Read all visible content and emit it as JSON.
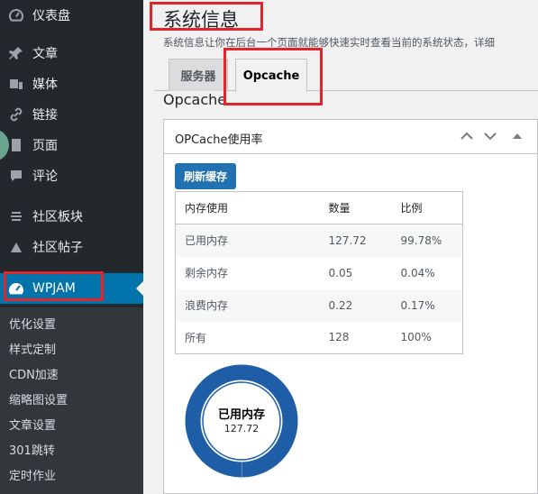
{
  "sidebar": {
    "items": [
      {
        "label": "仪表盘",
        "icon": "dashboard-icon"
      },
      {
        "label": "文章",
        "icon": "pin-icon"
      },
      {
        "label": "媒体",
        "icon": "media-icon"
      },
      {
        "label": "链接",
        "icon": "link-icon"
      },
      {
        "label": "页面",
        "icon": "page-icon"
      },
      {
        "label": "评论",
        "icon": "comment-icon"
      },
      {
        "label": "社区板块",
        "icon": "forum-icon"
      },
      {
        "label": "社区帖子",
        "icon": "topic-icon"
      },
      {
        "label": "WPJAM",
        "icon": "gauge-icon"
      }
    ],
    "submenu": [
      "优化设置",
      "样式定制",
      "CDN加速",
      "缩略图设置",
      "文章设置",
      "301跳转",
      "定时作业"
    ]
  },
  "main": {
    "title": "系统信息",
    "description": "系统信息让你在后台一个页面就能够快速实时查看当前的系统状态，详细",
    "tabs": [
      {
        "label": "服务器"
      },
      {
        "label": "Opcache"
      }
    ],
    "section_heading": "Opcache",
    "box": {
      "title": "OPCache使用率",
      "refresh_label": "刷新缓存",
      "table": {
        "headers": [
          "内存使用",
          "数量",
          "比例"
        ],
        "rows": [
          [
            "已用内存",
            "127.72",
            "99.78%"
          ],
          [
            "剩余内存",
            "0.05",
            "0.04%"
          ],
          [
            "浪费内存",
            "0.22",
            "0.17%"
          ],
          [
            "所有",
            "128",
            "100%"
          ]
        ]
      },
      "donut": {
        "center_label": "已用内存",
        "center_value": "127.72",
        "used_fraction": 0.9978,
        "color": "#1e5ea6"
      }
    }
  },
  "colors": {
    "sidebar_bg": "#23282d",
    "accent": "#0073aa",
    "highlight_box": "#e0262b"
  }
}
